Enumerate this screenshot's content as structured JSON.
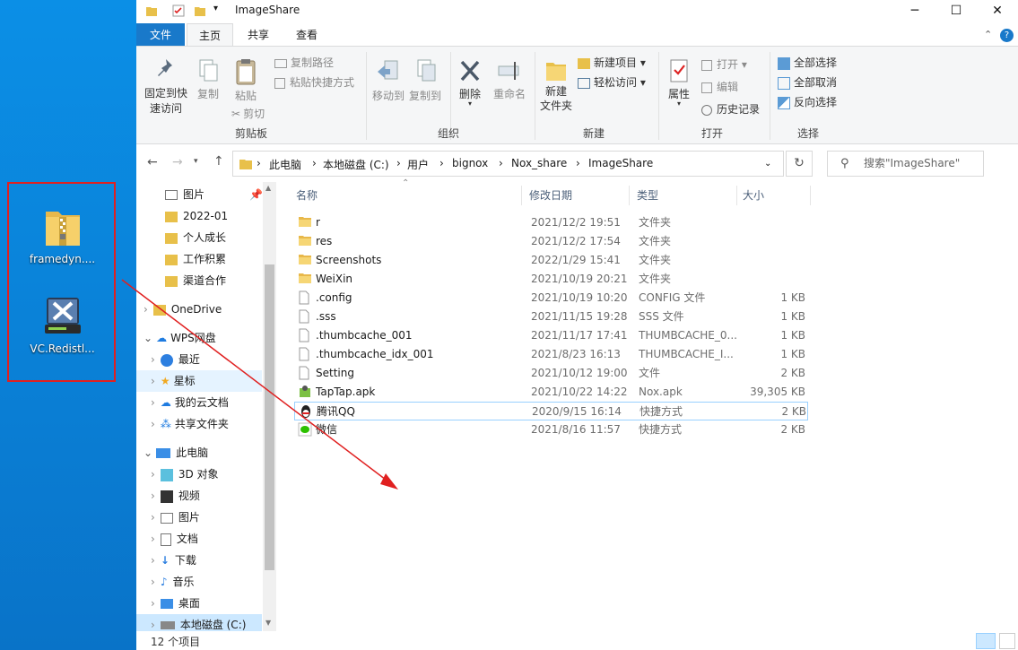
{
  "window": {
    "title": "ImageShare"
  },
  "tabs": {
    "file": "文件",
    "home": "主页",
    "share": "共享",
    "view": "查看"
  },
  "ribbon": {
    "pin": "固定到快速访问",
    "pin_l1": "固定到快",
    "pin_l2": "速访问",
    "copy": "复制",
    "paste": "粘贴",
    "copy_path": "复制路径",
    "paste_shortcut": "粘贴快捷方式",
    "cut": "剪切",
    "group_clipboard": "剪贴板",
    "move_to": "移动到",
    "copy_to": "复制到",
    "delete": "删除",
    "rename": "重命名",
    "group_organize": "组织",
    "new_folder_l1": "新建",
    "new_folder_l2": "文件夹",
    "new_item": "新建项目",
    "easy_access": "轻松访问",
    "group_new": "新建",
    "properties": "属性",
    "open": "打开",
    "edit": "编辑",
    "history": "历史记录",
    "group_open": "打开",
    "select_all": "全部选择",
    "select_none": "全部取消",
    "invert": "反向选择",
    "group_select": "选择"
  },
  "address": {
    "crumbs": [
      "此电脑",
      "本地磁盘 (C:)",
      "用户",
      "bignox",
      "Nox_share",
      "ImageShare"
    ],
    "search_placeholder": "搜索\"ImageShare\""
  },
  "nav": {
    "items": [
      {
        "label": "图片",
        "pinned": true
      },
      {
        "label": "2022-01"
      },
      {
        "label": "个人成长"
      },
      {
        "label": "工作积累"
      },
      {
        "label": "渠道合作"
      },
      {
        "label": "OneDrive"
      },
      {
        "label": "WPS网盘"
      },
      {
        "label": "最近"
      },
      {
        "label": "星标"
      },
      {
        "label": "我的云文档"
      },
      {
        "label": "共享文件夹"
      },
      {
        "label": "此电脑"
      },
      {
        "label": "3D 对象"
      },
      {
        "label": "视频"
      },
      {
        "label": "图片"
      },
      {
        "label": "文档"
      },
      {
        "label": "下载"
      },
      {
        "label": "音乐"
      },
      {
        "label": "桌面"
      },
      {
        "label": "本地磁盘 (C:)"
      }
    ]
  },
  "columns": {
    "name": "名称",
    "date": "修改日期",
    "type": "类型",
    "size": "大小"
  },
  "files": [
    {
      "name": "r",
      "date": "2021/12/2 19:51",
      "type": "文件夹",
      "size": "",
      "icon": "folder-icon"
    },
    {
      "name": "res",
      "date": "2021/12/2 17:54",
      "type": "文件夹",
      "size": "",
      "icon": "folder-icon"
    },
    {
      "name": "Screenshots",
      "date": "2022/1/29 15:41",
      "type": "文件夹",
      "size": "",
      "icon": "folder-icon"
    },
    {
      "name": "WeiXin",
      "date": "2021/10/19 20:21",
      "type": "文件夹",
      "size": "",
      "icon": "folder-icon"
    },
    {
      "name": ".config",
      "date": "2021/10/19 10:20",
      "type": "CONFIG 文件",
      "size": "1 KB",
      "icon": "file-icon"
    },
    {
      "name": ".sss",
      "date": "2021/11/15 19:28",
      "type": "SSS 文件",
      "size": "1 KB",
      "icon": "file-icon"
    },
    {
      "name": ".thumbcache_001",
      "date": "2021/11/17 17:41",
      "type": "THUMBCACHE_0...",
      "size": "1 KB",
      "icon": "file-icon"
    },
    {
      "name": ".thumbcache_idx_001",
      "date": "2021/8/23 16:13",
      "type": "THUMBCACHE_I...",
      "size": "1 KB",
      "icon": "file-icon"
    },
    {
      "name": "Setting",
      "date": "2021/10/12 19:00",
      "type": "文件",
      "size": "2 KB",
      "icon": "file-icon"
    },
    {
      "name": "TapTap.apk",
      "date": "2021/10/22 14:22",
      "type": "Nox.apk",
      "size": "39,305 KB",
      "icon": "apk-icon"
    },
    {
      "name": "腾讯QQ",
      "date": "2020/9/15 16:14",
      "type": "快捷方式",
      "size": "2 KB",
      "icon": "qq-icon"
    },
    {
      "name": "微信",
      "date": "2021/8/16 11:57",
      "type": "快捷方式",
      "size": "2 KB",
      "icon": "wechat-icon"
    }
  ],
  "status": {
    "count": "12 个项目"
  },
  "desktop": {
    "icon1": "framedyn....",
    "icon2": "VC.Redistl..."
  }
}
